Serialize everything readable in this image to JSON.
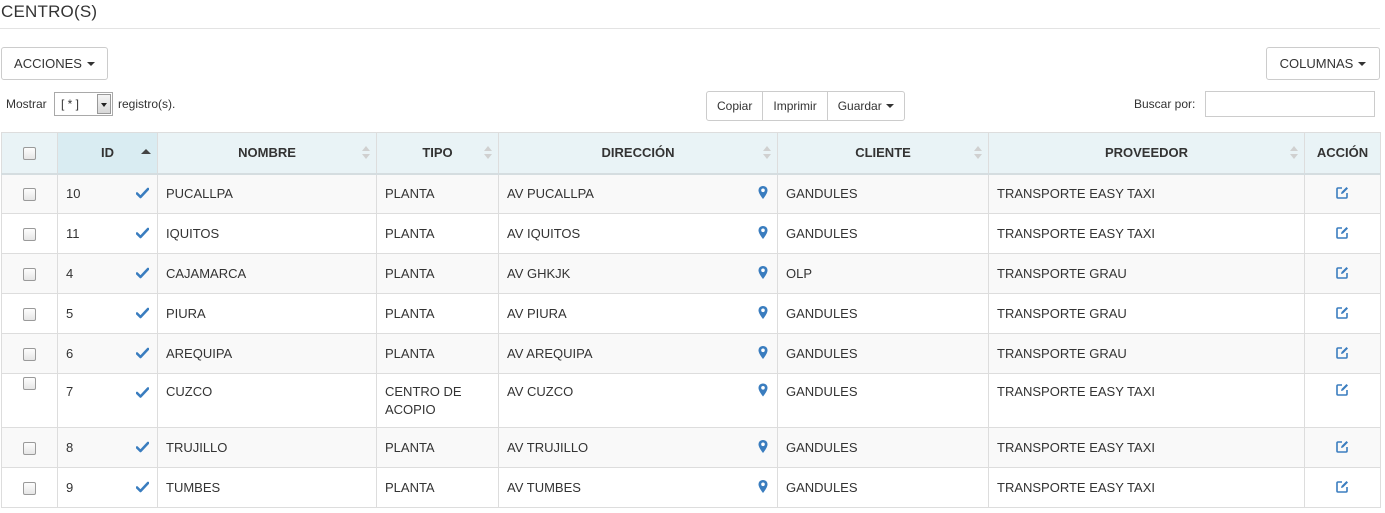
{
  "page": {
    "title": "CENTRO(S)"
  },
  "toolbar": {
    "acciones_label": "ACCIONES",
    "columnas_label": "COLUMNAS"
  },
  "pagination": {
    "show_label": "Mostrar",
    "page_size_value": "[ * ]",
    "show_suffix": "registro(s)."
  },
  "export": {
    "copy_label": "Copiar",
    "print_label": "Imprimir",
    "save_label": "Guardar"
  },
  "search": {
    "label": "Buscar por:",
    "value": "",
    "placeholder": ""
  },
  "table": {
    "columns": [
      "ID",
      "NOMBRE",
      "TIPO",
      "DIRECCIÓN",
      "CLIENTE",
      "PROVEEDOR",
      "ACCIÓN"
    ],
    "sorted_column": "ID",
    "sort_direction": "asc",
    "rows": [
      {
        "id": "10",
        "nombre": "PUCALLPA",
        "tipo": "PLANTA",
        "direccion": "AV PUCALLPA",
        "cliente": "GANDULES",
        "proveedor": "TRANSPORTE EASY TAXI"
      },
      {
        "id": "11",
        "nombre": "IQUITOS",
        "tipo": "PLANTA",
        "direccion": "AV IQUITOS",
        "cliente": "GANDULES",
        "proveedor": "TRANSPORTE EASY TAXI"
      },
      {
        "id": "4",
        "nombre": "CAJAMARCA",
        "tipo": "PLANTA",
        "direccion": "AV GHKJK",
        "cliente": "OLP",
        "proveedor": "TRANSPORTE GRAU"
      },
      {
        "id": "5",
        "nombre": "PIURA",
        "tipo": "PLANTA",
        "direccion": "AV PIURA",
        "cliente": "GANDULES",
        "proveedor": "TRANSPORTE GRAU"
      },
      {
        "id": "6",
        "nombre": "AREQUIPA",
        "tipo": "PLANTA",
        "direccion": "AV AREQUIPA",
        "cliente": "GANDULES",
        "proveedor": "TRANSPORTE GRAU"
      },
      {
        "id": "7",
        "nombre": "CUZCO",
        "tipo": "CENTRO DE ACOPIO",
        "direccion": "AV CUZCO",
        "cliente": "GANDULES",
        "proveedor": "TRANSPORTE EASY TAXI"
      },
      {
        "id": "8",
        "nombre": "TRUJILLO",
        "tipo": "PLANTA",
        "direccion": "AV TRUJILLO",
        "cliente": "GANDULES",
        "proveedor": "TRANSPORTE EASY TAXI"
      },
      {
        "id": "9",
        "nombre": "TUMBES",
        "tipo": "PLANTA",
        "direccion": "AV TUMBES",
        "cliente": "GANDULES",
        "proveedor": "TRANSPORTE EASY TAXI"
      }
    ]
  },
  "icons": {
    "row_status": "check-icon",
    "address": "map-marker-icon",
    "action": "edit-icon",
    "accent_color": "#3a7dbf"
  }
}
